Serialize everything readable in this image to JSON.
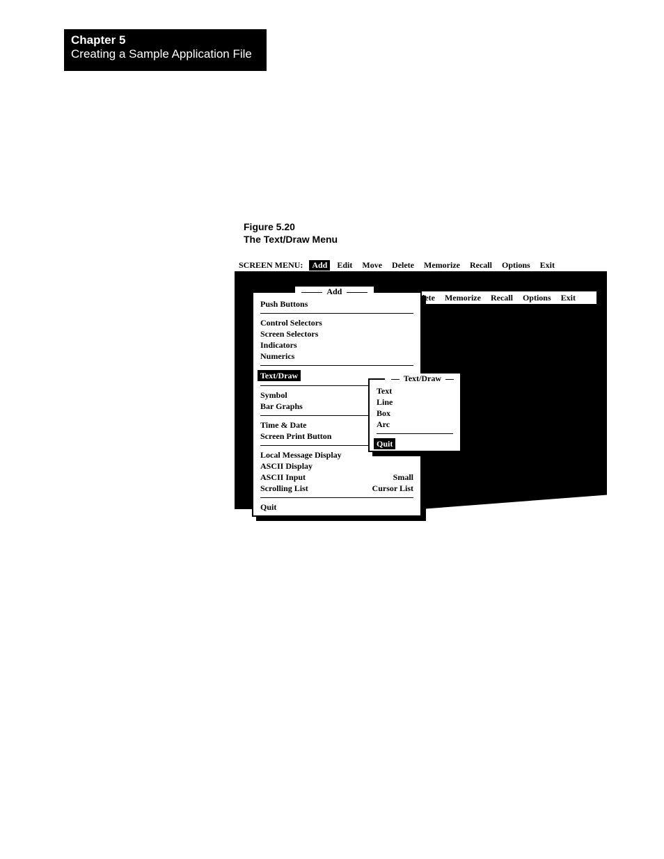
{
  "chapter": {
    "number": "Chapter 5",
    "title": "Creating a Sample Application File"
  },
  "figure": {
    "num": "Figure 5.20",
    "title": "The Text/Draw Menu"
  },
  "menubar": {
    "label": "SCREEN MENU:",
    "items": [
      "Add",
      "Edit",
      "Move",
      "Delete",
      "Memorize",
      "Recall",
      "Options",
      "Exit"
    ],
    "highlighted": "Add"
  },
  "inner_menubar_visible": [
    "lete",
    "Memorize",
    "Recall",
    "Options",
    "Exit"
  ],
  "add_menu": {
    "title": "Add",
    "groups": [
      [
        "Push Buttons"
      ],
      [
        "Control Selectors",
        "Screen  Selectors",
        "Indicators",
        "Numerics"
      ],
      [
        "Text/Draw"
      ],
      [
        "Symbol",
        "Bar Graphs"
      ],
      [
        "Time & Date",
        "Screen Print Button"
      ],
      [
        "Local Message Display",
        "ASCII Display",
        "ASCII Input",
        "Scrolling List"
      ],
      [
        "Quit"
      ]
    ],
    "highlighted": "Text/Draw",
    "right_labels": {
      "ASCII Input": "Small",
      "Scrolling List": "Cursor List"
    }
  },
  "textdraw_menu": {
    "title": "Text/Draw",
    "items": [
      "Text",
      "Line",
      "Box",
      "Arc"
    ],
    "quit": "Quit",
    "highlighted": "Quit"
  }
}
